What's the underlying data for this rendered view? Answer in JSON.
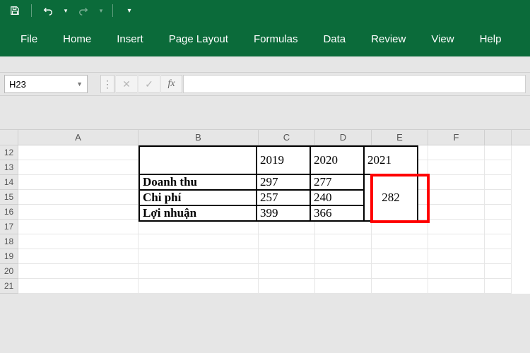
{
  "qat": {
    "save": "save",
    "undo": "undo",
    "redo": "redo"
  },
  "tabs": [
    "File",
    "Home",
    "Insert",
    "Page Layout",
    "Formulas",
    "Data",
    "Review",
    "View",
    "Help"
  ],
  "namebox": "H23",
  "fx_label": "fx",
  "columns": [
    "A",
    "B",
    "C",
    "D",
    "E",
    "F"
  ],
  "rows": [
    "12",
    "13",
    "14",
    "15",
    "16",
    "17",
    "18",
    "19",
    "20",
    "21"
  ],
  "table": {
    "years": [
      "2019",
      "2020",
      "2021"
    ],
    "rows": [
      {
        "label": "Doanh thu",
        "c": "297",
        "d": "277"
      },
      {
        "label": "Chi phí",
        "c": "257",
        "d": "240"
      },
      {
        "label": "Lợi nhuận",
        "c": "399",
        "d": "366"
      }
    ],
    "merged_e": "282"
  }
}
